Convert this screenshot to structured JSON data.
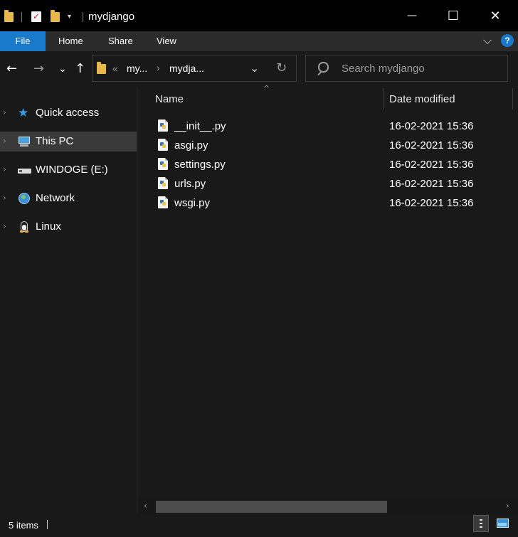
{
  "window": {
    "title": "mydjango",
    "minimize_glyph": "—",
    "maximize_glyph": "☐",
    "close_glyph": "✕"
  },
  "ribbon": {
    "tabs": [
      "File",
      "Home",
      "Share",
      "View"
    ],
    "expand_glyph": "⌵",
    "help_glyph": "?"
  },
  "nav": {
    "back_glyph": "←",
    "forward_glyph": "→",
    "recent_glyph": "⌄",
    "up_glyph": "↑"
  },
  "address": {
    "overflow": "«",
    "crumbs": [
      "my...",
      "mydja..."
    ],
    "crumb_sep": "›",
    "dropdown_glyph": "⌄",
    "refresh_glyph": "↻"
  },
  "search": {
    "placeholder": "Search mydjango"
  },
  "sidebar": {
    "items": [
      {
        "label": "Quick access",
        "icon": "star-icon"
      },
      {
        "label": "This PC",
        "icon": "computer-icon"
      },
      {
        "label": "WINDOGE (E:)",
        "icon": "drive-icon"
      },
      {
        "label": "Network",
        "icon": "network-icon"
      },
      {
        "label": "Linux",
        "icon": "linux-icon"
      }
    ]
  },
  "columns": {
    "name": "Name",
    "date": "Date modified",
    "sort_glyph": "^"
  },
  "files": [
    {
      "name": "__init__.py",
      "date": "16-02-2021 15:36"
    },
    {
      "name": "asgi.py",
      "date": "16-02-2021 15:36"
    },
    {
      "name": "settings.py",
      "date": "16-02-2021 15:36"
    },
    {
      "name": "urls.py",
      "date": "16-02-2021 15:36"
    },
    {
      "name": "wsgi.py",
      "date": "16-02-2021 15:36"
    }
  ],
  "status": {
    "item_count": "5 items"
  },
  "colors": {
    "accent": "#1979ca",
    "background": "#191919",
    "selection": "#3a3a3a"
  }
}
